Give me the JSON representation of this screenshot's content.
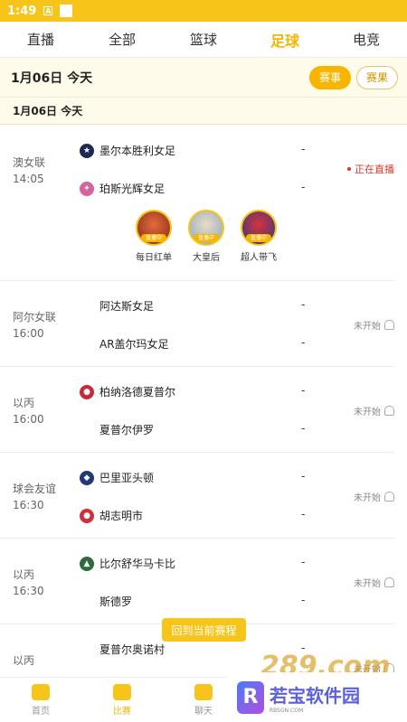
{
  "status": {
    "time": "1:49",
    "icon_a": "A"
  },
  "tabs": [
    {
      "label": "直播"
    },
    {
      "label": "全部"
    },
    {
      "label": "篮球"
    },
    {
      "label": "足球"
    },
    {
      "label": "电竞"
    }
  ],
  "datebar": {
    "date": "1月06日  今天",
    "btn_events": "赛事",
    "btn_results": "赛果"
  },
  "subdate": "1月06日  今天",
  "matches": [
    {
      "league": "澳女联",
      "time": "14:05",
      "home": "墨尔本胜利女足",
      "away": "珀斯光辉女足",
      "home_score": "-",
      "away_score": "-",
      "state": "正在直播"
    },
    {
      "league": "阿尔女联",
      "time": "16:00",
      "home": "阿达斯女足",
      "away": "AR盖尔玛女足",
      "home_score": "-",
      "away_score": "-",
      "state": "未开始"
    },
    {
      "league": "以丙",
      "time": "16:00",
      "home": "柏纳洛德夏普尔",
      "away": "夏普尔伊罗",
      "home_score": "-",
      "away_score": "-",
      "state": "未开始"
    },
    {
      "league": "球会友谊",
      "time": "16:30",
      "home": "巴里亚头顿",
      "away": "胡志明市",
      "home_score": "-",
      "away_score": "-",
      "state": "未开始"
    },
    {
      "league": "以丙",
      "time": "16:30",
      "home": "比尔舒华马卡比",
      "away": "斯德罗",
      "home_score": "-",
      "away_score": "-",
      "state": "未开始"
    },
    {
      "league": "以丙",
      "time": "",
      "home": "夏普尔奥诺村",
      "away": "",
      "home_score": "-",
      "away_score": "",
      "state": "未开始"
    }
  ],
  "streamers": [
    {
      "name": "每日红单",
      "tag": "直播中"
    },
    {
      "name": "大皇后",
      "tag": "直播中"
    },
    {
      "name": "超人带飞",
      "tag": "直播中"
    }
  ],
  "float_button": "回到当前赛程",
  "bottom_nav": [
    {
      "label": "首页"
    },
    {
      "label": "比赛"
    },
    {
      "label": "聊天"
    }
  ],
  "watermark": {
    "logo": "R",
    "brand": "若宝软件园",
    "sub": "RBSGN.COM",
    "num": "289.com"
  },
  "colors": {
    "accent": "#f7b500",
    "live": "#e0352b",
    "statusbar": "#f7c51a"
  }
}
